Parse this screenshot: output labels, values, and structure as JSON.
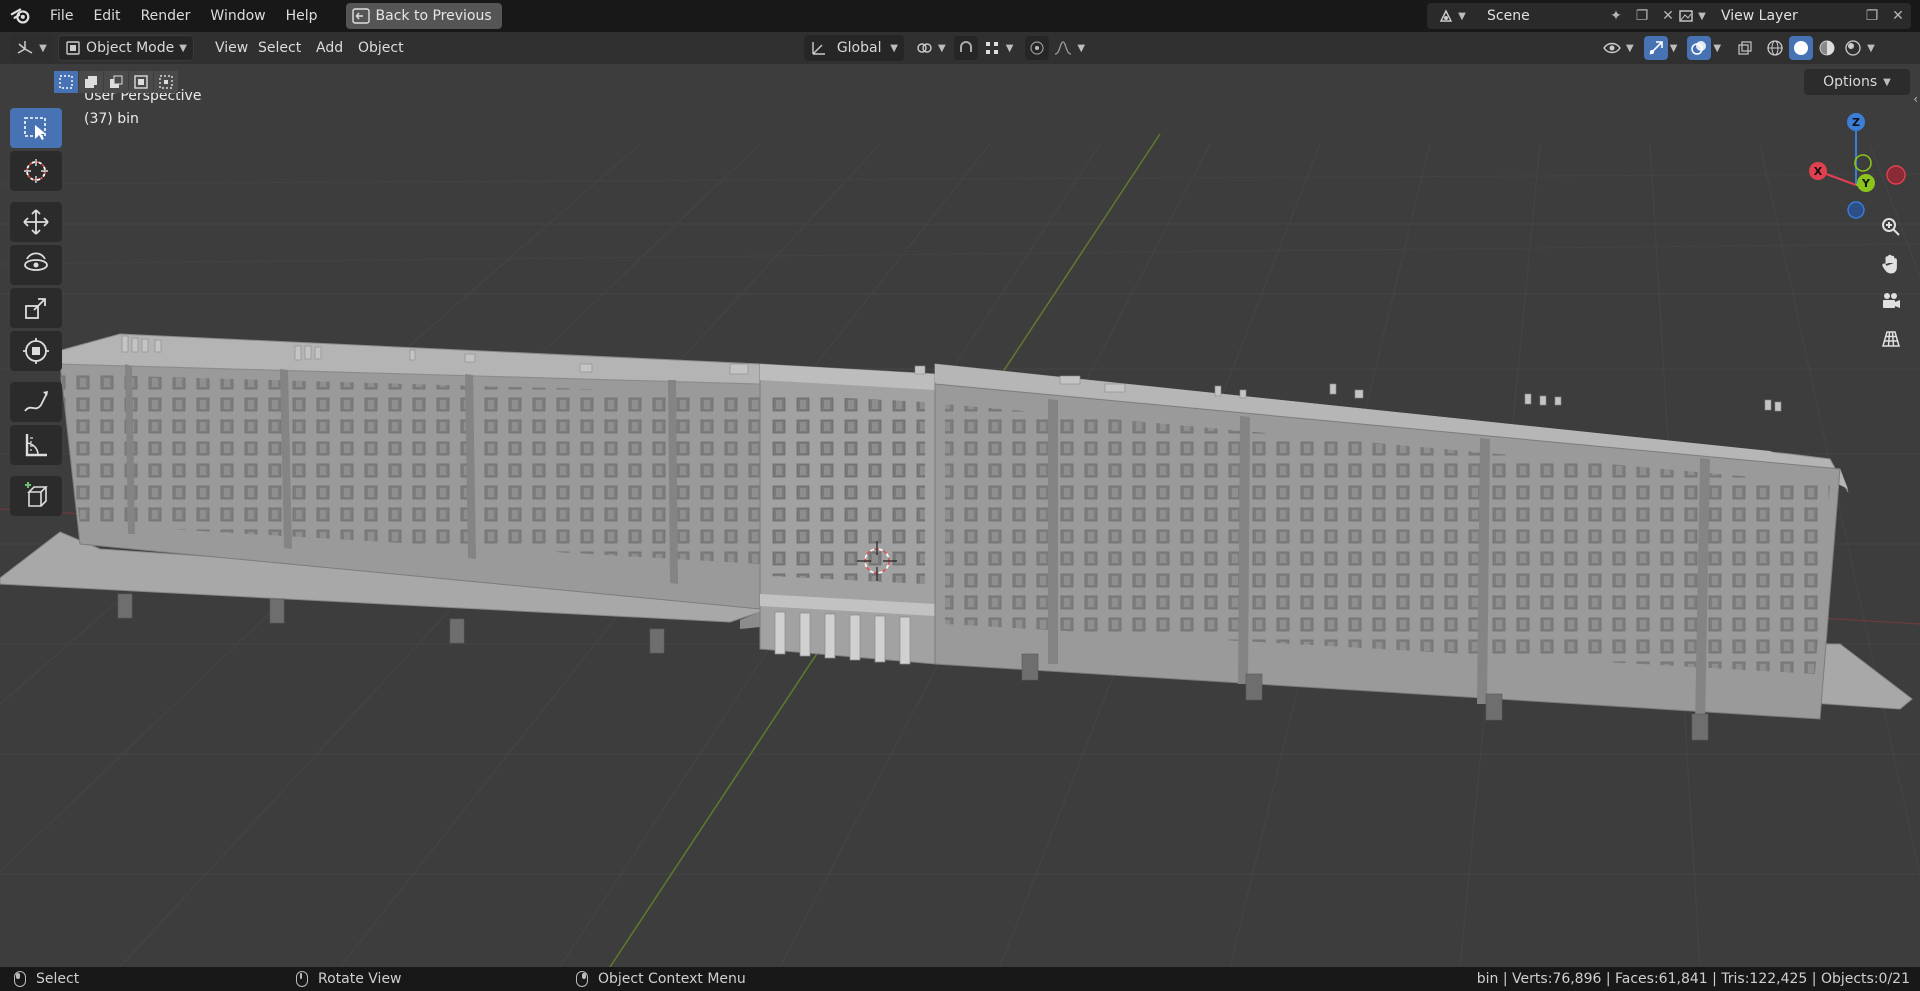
{
  "topbar": {
    "menus": [
      "File",
      "Edit",
      "Render",
      "Window",
      "Help"
    ],
    "back_button": "Back to Previous",
    "scene_name": "Scene",
    "view_layer_name": "View Layer"
  },
  "viewport_header": {
    "mode": "Object Mode",
    "menus": [
      "View",
      "Select",
      "Add",
      "Object"
    ],
    "transform_orientation": "Global"
  },
  "tool_settings": {
    "options_label": "Options"
  },
  "viewport": {
    "perspective_label": "User Perspective",
    "object_label": "(37) bin",
    "gizmo": {
      "z": "Z",
      "x": "X",
      "y": "Y"
    }
  },
  "statusbar": {
    "left_click": "Select",
    "middle_click": "Rotate View",
    "right_click": "Object Context Menu",
    "stats": "bin | Verts:76,896 | Faces:61,841 | Tris:122,425 | Objects:0/21"
  },
  "colors": {
    "accent": "#4772b3",
    "axis_x": "#e04050",
    "axis_y": "#8bc51c",
    "axis_z": "#3b7ed8",
    "viewport_bg": "#3d3d3d",
    "building": "#9c9c9c"
  },
  "icons": [
    "blender-logo-icon",
    "back-icon",
    "select-box-icon",
    "cursor-icon",
    "move-icon",
    "rotate-icon",
    "scale-icon",
    "transform-icon",
    "annotate-icon",
    "measure-icon",
    "add-cube-icon",
    "zoom-icon",
    "hand-icon",
    "camera-icon",
    "grid-icon"
  ]
}
